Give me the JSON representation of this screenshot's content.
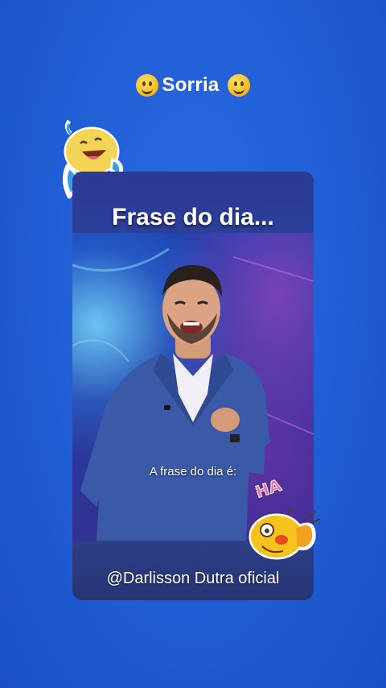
{
  "header": {
    "title": "Sorria",
    "left_emoji": "smiley-emoji",
    "right_emoji": "smiley-emoji"
  },
  "card": {
    "title": "Frase do dia...",
    "subtitle": "A frase do dia é:",
    "handle": "@Darlisson Dutra oficial"
  },
  "stickers": {
    "top": "laughing-fish-sticker",
    "bottom": "laughing-chick-sticker",
    "bottom_text": "HA"
  },
  "colors": {
    "background": "#2260d8",
    "card": "#2a3b8f",
    "text": "#ffffff",
    "sticker_yellow": "#f6c21c"
  }
}
